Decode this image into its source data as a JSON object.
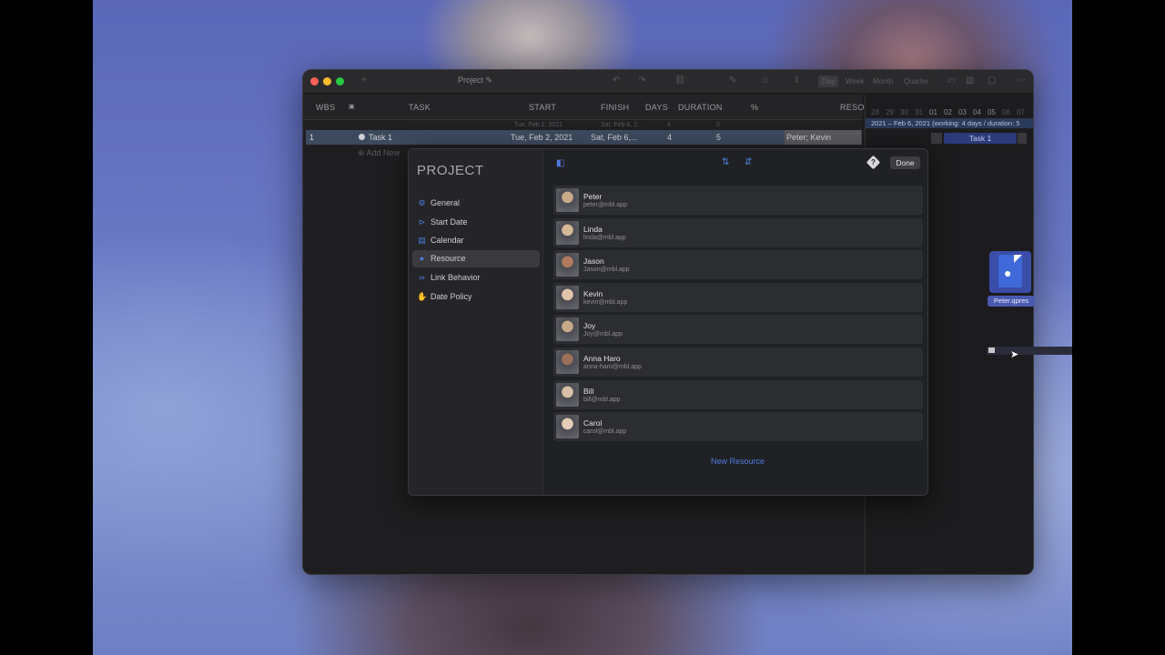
{
  "window": {
    "title": "Project ✎"
  },
  "toolbar": {
    "zoom_day": "Day",
    "zoom_week": "Week",
    "zoom_month": "Month",
    "zoom_quarter": "Quarter"
  },
  "table": {
    "headers": {
      "wbs": "WBS",
      "task": "TASK",
      "start": "START",
      "finish": "FINISH",
      "days": "DAYS",
      "duration": "DURATION",
      "percent": "%",
      "resources": "RESO"
    },
    "summary": {
      "start": "Tue, Feb 2, 2021",
      "finish": "Sat, Feb 6, 2...",
      "days": "4",
      "duration": "5"
    },
    "task": {
      "wbs": "1",
      "name": "Task 1",
      "start": "Tue, Feb 2, 2021",
      "finish": "Sat, Feb 6,...",
      "days": "4",
      "duration": "5",
      "resources": "Peter; Kevin"
    },
    "add_new": "Add New"
  },
  "gantt": {
    "days": [
      "28",
      "29",
      "30",
      "31",
      "01",
      "02",
      "03",
      "04",
      "05",
      "06",
      "07"
    ],
    "info": "2021 – Feb 6, 2021 (working: 4 days / duration: 5",
    "bar_label": "Task 1"
  },
  "modal": {
    "title": "PROJECT",
    "nav": [
      {
        "label": "General",
        "icon": "gears-icon"
      },
      {
        "label": "Start Date",
        "icon": "start-date-icon"
      },
      {
        "label": "Calendar",
        "icon": "calendar-icon"
      },
      {
        "label": "Resource",
        "icon": "person-icon"
      },
      {
        "label": "Link Behavior",
        "icon": "link-icon"
      },
      {
        "label": "Date Policy",
        "icon": "hand-icon"
      }
    ],
    "active_nav": "Resource",
    "done_label": "Done",
    "help_label": "?",
    "resources": [
      {
        "name": "Peter",
        "email": "peter@mbl.app"
      },
      {
        "name": "Linda",
        "email": "linda@mbl.app"
      },
      {
        "name": "Jason",
        "email": "Jason@mbl.app"
      },
      {
        "name": "Kevin",
        "email": "kevin@mbl.app"
      },
      {
        "name": "Joy",
        "email": "Joy@mbl.app"
      },
      {
        "name": "Anna Haro",
        "email": "anna-haro@mbl.app"
      },
      {
        "name": "Bill",
        "email": "bill@mbl.app"
      },
      {
        "name": "Carol",
        "email": "carol@mbl.app"
      }
    ],
    "new_resource_label": "New Resource"
  },
  "desktop": {
    "file_label": "Peter.qpres"
  },
  "colors": {
    "accent": "#4d7ce0",
    "selected_row": "#3d4a5e",
    "gantt_bar": "#2c3a7a"
  }
}
